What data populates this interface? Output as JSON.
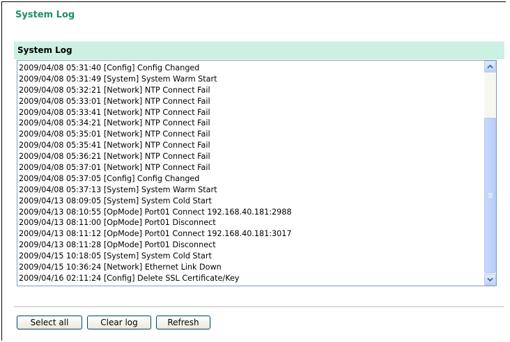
{
  "page": {
    "title": "System Log"
  },
  "section": {
    "header": "System Log"
  },
  "log": {
    "lines": [
      "2009/04/08 05:31:40 [Config] Config Changed",
      "2009/04/08 05:31:49 [System] System Warm Start",
      "2009/04/08 05:32:21 [Network] NTP Connect Fail",
      "2009/04/08 05:33:01 [Network] NTP Connect Fail",
      "2009/04/08 05:33:41 [Network] NTP Connect Fail",
      "2009/04/08 05:34:21 [Network] NTP Connect Fail",
      "2009/04/08 05:35:01 [Network] NTP Connect Fail",
      "2009/04/08 05:35:41 [Network] NTP Connect Fail",
      "2009/04/08 05:36:21 [Network] NTP Connect Fail",
      "2009/04/08 05:37:01 [Network] NTP Connect Fail",
      "2009/04/08 05:37:05 [Config] Config Changed",
      "2009/04/08 05:37:13 [System] System Warm Start",
      "2009/04/13 08:09:05 [System] System Cold Start",
      "2009/04/13 08:10:55 [OpMode] Port01 Connect 192.168.40.181:2988",
      "2009/04/13 08:11:00 [OpMode] Port01 Disconnect",
      "2009/04/13 08:11:12 [OpMode] Port01 Connect 192.168.40.181:3017",
      "2009/04/13 08:11:28 [OpMode] Port01 Disconnect",
      "2009/04/15 10:18:05 [System] System Cold Start",
      "2009/04/15 10:36:24 [Network] Ethernet Link Down",
      "2009/04/16 02:11:24 [Config] Delete SSL Certificate/Key"
    ]
  },
  "buttons": {
    "select_all": "Select all",
    "clear_log": "Clear log",
    "refresh": "Refresh"
  },
  "icons": {
    "scroll_up": "chevron-up-icon",
    "scroll_down": "chevron-down-icon"
  },
  "colors": {
    "title": "#1a8f6a",
    "section_header_bg": "#ccf0e2",
    "scrollbar_accent": "#b9cdf7"
  }
}
